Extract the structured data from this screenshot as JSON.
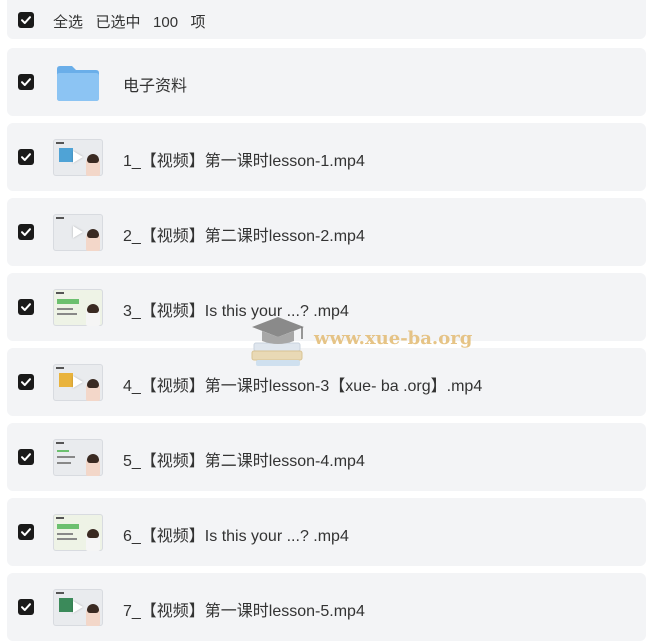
{
  "header": {
    "select_all_text": "全选   已选中   100   项"
  },
  "items": [
    {
      "name": "电子资料",
      "type": "folder"
    },
    {
      "name": "1_【视频】第一课时lesson-1.mp4",
      "type": "video"
    },
    {
      "name": "2_【视频】第二课时lesson-2.mp4",
      "type": "video"
    },
    {
      "name": "3_【视频】Is this your ...? .mp4",
      "type": "video"
    },
    {
      "name": "4_【视频】第一课时lesson-3【xue- ba .org】.mp4",
      "type": "video"
    },
    {
      "name": "5_【视频】第二课时lesson-4.mp4",
      "type": "video"
    },
    {
      "name": "6_【视频】Is this your ...? .mp4",
      "type": "video"
    },
    {
      "name": "7_【视频】第一课时lesson-5.mp4",
      "type": "video"
    }
  ],
  "watermark": {
    "text": "www.xue-ba.org"
  },
  "colors": {
    "row_bg": "#f3f4f6",
    "checkbox": "#1a1a1a",
    "folder": "#7ab8f0",
    "watermark": "#e4be7a"
  },
  "icons": {
    "checkbox": "check-icon",
    "folder": "folder-icon",
    "video": "video-thumbnail"
  }
}
